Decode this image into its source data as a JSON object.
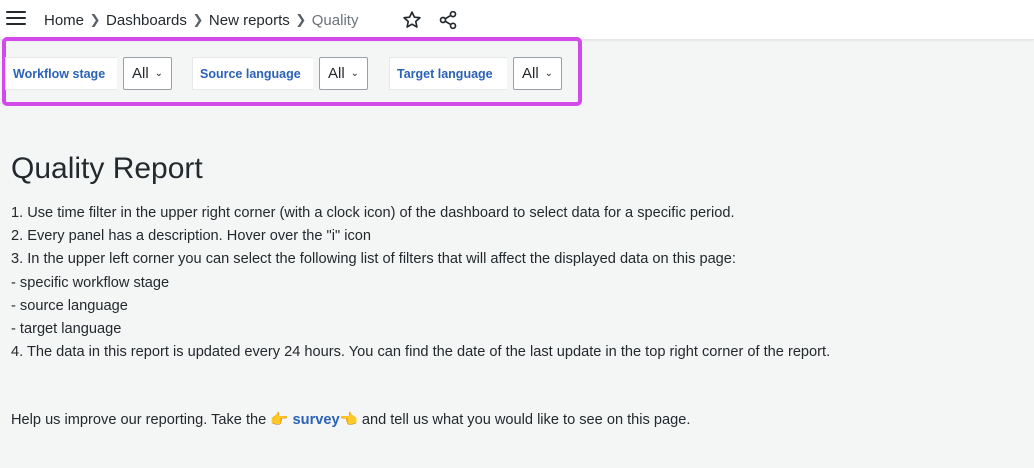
{
  "breadcrumb": {
    "items": [
      "Home",
      "Dashboards",
      "New reports"
    ],
    "current": "Quality"
  },
  "icons": {
    "menu": "hamburger-menu-icon",
    "star": "star-outline-icon",
    "share": "share-icon",
    "separator": "chevron-right-icon"
  },
  "filters": [
    {
      "label": "Workflow stage",
      "value": "All"
    },
    {
      "label": "Source language",
      "value": "All"
    },
    {
      "label": "Target language",
      "value": "All"
    }
  ],
  "content": {
    "title": "Quality Report",
    "lines": [
      "1. Use time filter in the upper right corner (with a clock icon) of the dashboard to select data for a specific period.",
      "2. Every panel has a description. Hover over the \"i\" icon",
      "3. In the upper left corner you can select the following list of filters that will affect the displayed data on this page:",
      "- specific workflow stage",
      "- source language",
      "- target language",
      "4. The data in this report is updated every 24 hours. You can find the date of the last update in the top right corner of the report."
    ],
    "help": {
      "prefix": "Help us improve our reporting. Take the ",
      "emoji_before": "👉",
      "link": "survey",
      "emoji_after": "👈",
      "suffix": " and tell us what you would like to see on this page."
    }
  },
  "colors": {
    "accent": "#2b62b8",
    "highlight": "#d24bea",
    "background": "#f4f5f5"
  }
}
